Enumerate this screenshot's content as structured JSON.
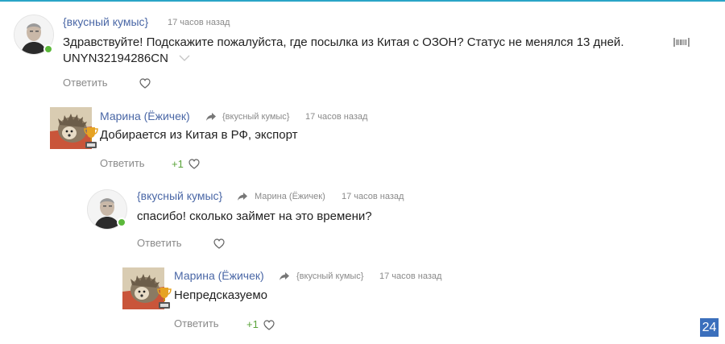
{
  "comments": [
    {
      "author": "{вкусный кумыс}",
      "reply_to": "",
      "time": "17 часов назад",
      "text_line1": "Здравствуйте! Подскажите пожалуйста, где посылка из Китая с ОЗОН? Статус не менялся 13 дней.",
      "tracking_code": "UNYN32194286CN",
      "reply_label": "Ответить",
      "likes": ""
    },
    {
      "author": "Марина (Ёжичек)",
      "reply_to": "{вкусный кумыс}",
      "time": "17 часов назад",
      "text": "Добирается из Китая в РФ, экспорт",
      "reply_label": "Ответить",
      "likes": "+1"
    },
    {
      "author": "{вкусный кумыс}",
      "reply_to": "Марина (Ёжичек)",
      "time": "17 часов назад",
      "text": "спасибо! сколько займет на это времени?",
      "reply_label": "Ответить",
      "likes": ""
    },
    {
      "author": "Марина (Ёжичек)",
      "reply_to": "{вкусный кумыс}",
      "time": "17 часов назад",
      "text": "Непредсказуемо",
      "reply_label": "Ответить",
      "likes": "+1"
    }
  ],
  "corner_badge": "24",
  "colors": {
    "author": "#4a67a6",
    "likes": "#5aa33a",
    "online": "#5bb83a",
    "badge": "#3b6fbc",
    "top_line": "#2aa5c7"
  }
}
